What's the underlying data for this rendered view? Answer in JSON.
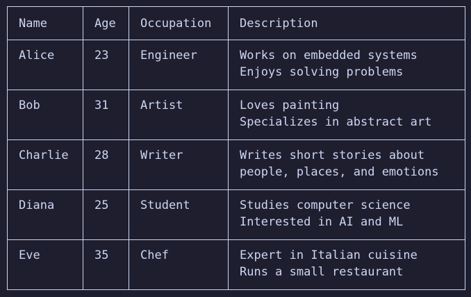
{
  "table": {
    "headers": [
      "Name",
      "Age",
      "Occupation",
      "Description"
    ],
    "rows": [
      {
        "name": "Alice",
        "age": "23",
        "occupation": "Engineer",
        "description": [
          "Works on embedded systems",
          "Enjoys solving problems"
        ]
      },
      {
        "name": "Bob",
        "age": "31",
        "occupation": "Artist",
        "description": [
          "Loves painting",
          "Specializes in abstract art"
        ]
      },
      {
        "name": "Charlie",
        "age": "28",
        "occupation": "Writer",
        "description": [
          "Writes short stories about",
          "people, places, and emotions"
        ]
      },
      {
        "name": "Diana",
        "age": "25",
        "occupation": "Student",
        "description": [
          "Studies computer science",
          "Interested in AI and ML"
        ]
      },
      {
        "name": "Eve",
        "age": "35",
        "occupation": "Chef",
        "description": [
          "Expert in Italian cuisine",
          "Runs a small restaurant"
        ]
      }
    ]
  },
  "colors": {
    "background": "#1e1e2e",
    "text": "#cdd6f4",
    "border": "#cdd6f4"
  }
}
